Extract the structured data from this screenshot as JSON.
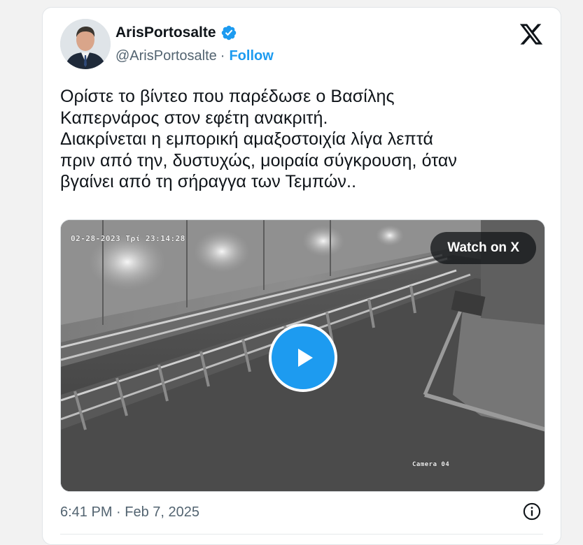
{
  "author": {
    "display_name": "ArisPortosalte",
    "handle": "@ArisPortosalte",
    "separator": "·",
    "follow_label": "Follow",
    "verified": true,
    "avatar_icon": "profile-photo"
  },
  "tweet": {
    "lines": [
      "Ορίστε το βίντεο που παρέδωσε ο Βασίλης",
      "Καπερνάρος στον εφέτη ανακριτή.",
      "Διακρίνεται η εμπορική αμαξοστοιχία λίγα λεπτά",
      "πριν από την, δυστυχώς, μοιραία σύγκρουση, όταν",
      "βγαίνει από τη σήραγγα των Τεμπών.."
    ]
  },
  "media": {
    "osd_datetime": "02-28-2023 Τρί 23:14:28",
    "osd_camera": "Camera 04",
    "watch_label": "Watch on X",
    "play_icon": "play-icon"
  },
  "footer": {
    "timestamp": "6:41 PM · Feb 7, 2025",
    "info_icon": "info-icon"
  },
  "colors": {
    "accent": "#1d9bf0",
    "text": "#0f1419",
    "muted": "#536471"
  }
}
